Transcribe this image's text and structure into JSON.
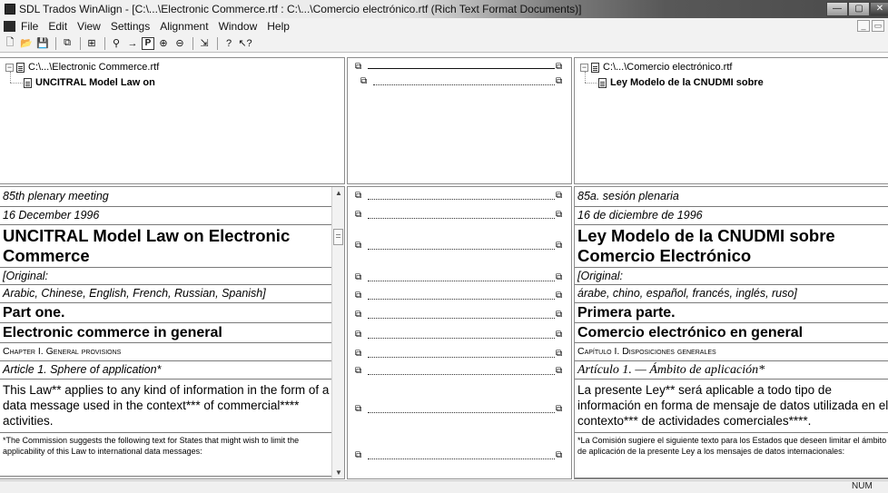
{
  "window": {
    "title": "SDL Trados WinAlign - [C:\\...\\Electronic Commerce.rtf : C:\\...\\Comercio electrónico.rtf (Rich Text Format Documents)]",
    "controls": {
      "minimize": "—",
      "maximize": "▢",
      "close": "✕"
    }
  },
  "menu": {
    "items": [
      "File",
      "Edit",
      "View",
      "Settings",
      "Alignment",
      "Window",
      "Help"
    ],
    "mdi_controls": {
      "minimize": "_",
      "restore": "▭"
    }
  },
  "toolbar": {
    "buttons": [
      {
        "name": "new-icon",
        "glyph": "🗋"
      },
      {
        "name": "open-icon",
        "glyph": "📂"
      },
      {
        "name": "save-icon",
        "glyph": "💾"
      },
      {
        "name": "copy-icon",
        "glyph": "⧉"
      },
      {
        "name": "properties-icon",
        "glyph": "⊞"
      },
      {
        "name": "find-icon",
        "glyph": "⚲"
      },
      {
        "name": "arrow-right-icon",
        "glyph": "→"
      },
      {
        "name": "paragraph-mode-icon",
        "glyph": "P"
      },
      {
        "name": "zoom-in-icon",
        "glyph": "⊕"
      },
      {
        "name": "zoom-out-icon",
        "glyph": "⊖"
      },
      {
        "name": "fit-icon",
        "glyph": "⇲"
      },
      {
        "name": "help-icon",
        "glyph": "?"
      },
      {
        "name": "context-help-icon",
        "glyph": "↖?"
      }
    ]
  },
  "tree": {
    "left": {
      "file": "C:\\...\\Electronic Commerce.rtf",
      "child": "UNCITRAL Model Law on"
    },
    "right": {
      "file": "C:\\...\\Comercio electrónico.rtf",
      "child": "Ley Modelo de la CNUDMI sobre"
    },
    "connector_icon": "⧉"
  },
  "segments": {
    "left": [
      "85th plenary meeting",
      "16 December 1996",
      "UNCITRAL Model Law on Electronic Commerce",
      "[Original:",
      "Arabic, Chinese, English, French, Russian, Spanish]",
      "Part one.",
      "Electronic commerce in general",
      "Chapter I. General provisions",
      "Article 1. Sphere of application*",
      "This Law** applies to any kind of information in the form of a data message used in the context*** of commercial**** activities.",
      "*The Commission suggests the following text for States that might wish to limit the applicability of this Law to international data messages:"
    ],
    "right": [
      "85a. sesión plenaria",
      "16 de diciembre de 1996",
      "Ley Modelo de la CNUDMI sobre Comercio Electrónico",
      "[Original:",
      "árabe, chino, español, francés, inglés, ruso]",
      "Primera parte.",
      "Comercio electrónico en general",
      "Capítulo I. Disposiciones generales",
      "Artículo 1. — Ámbito de aplicación*",
      "La presente Ley** será aplicable a todo tipo de información en forma de mensaje de datos utilizada en el contexto*** de actividades comerciales****.",
      "*La Comisión sugiere el siguiente texto para los Estados que deseen limitar el ámbito de aplicación de la presente Ley a los mensajes de datos internacionales:"
    ]
  },
  "scrollbar": {
    "up": "▲",
    "down": "▼"
  },
  "status": {
    "num": "NUM"
  }
}
